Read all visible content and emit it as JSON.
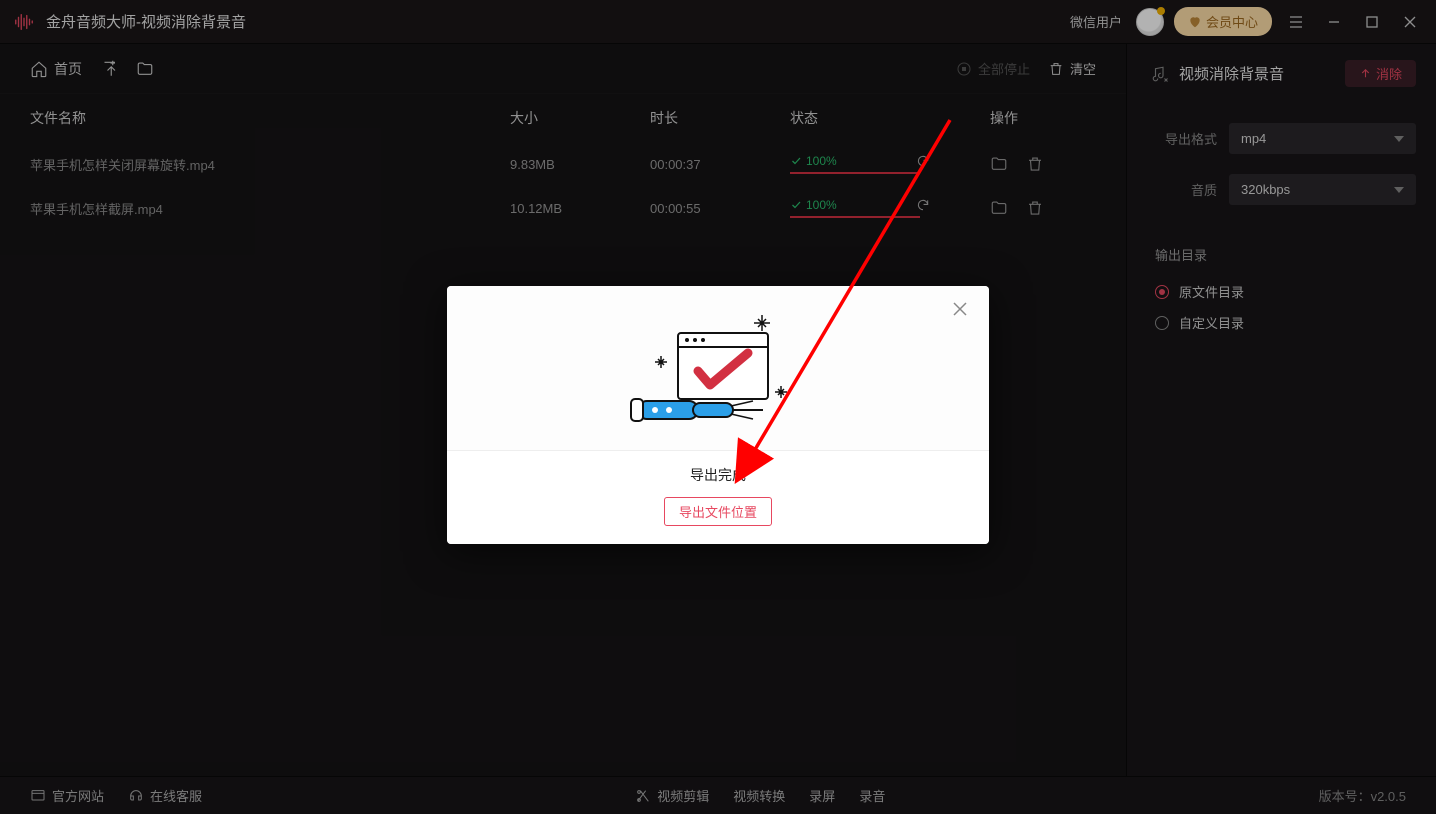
{
  "titlebar": {
    "app_title": "金舟音频大师-视频消除背景音",
    "wechat_user": "微信用户",
    "vip_label": "会员中心"
  },
  "toolbar": {
    "home": "首页",
    "stop_all": "全部停止",
    "clear": "清空"
  },
  "table": {
    "headers": {
      "name": "文件名称",
      "size": "大小",
      "duration": "时长",
      "status": "状态",
      "ops": "操作"
    },
    "rows": [
      {
        "name": "苹果手机怎样关闭屏幕旋转.mp4",
        "size": "9.83MB",
        "duration": "00:00:37",
        "percent": "100%"
      },
      {
        "name": "苹果手机怎样截屏.mp4",
        "size": "10.12MB",
        "duration": "00:00:55",
        "percent": "100%"
      }
    ]
  },
  "panel": {
    "title": "视频消除背景音",
    "remove_btn": "消除",
    "format_label": "导出格式",
    "format_value": "mp4",
    "quality_label": "音质",
    "quality_value": "320kbps",
    "output_title": "输出目录",
    "output_opt1": "原文件目录",
    "output_opt2": "自定义目录"
  },
  "footer": {
    "site": "官方网站",
    "support": "在线客服",
    "vedit": "视频剪辑",
    "vconvert": "视频转换",
    "screencap": "录屏",
    "audiorec": "录音",
    "version_label": "版本号：",
    "version_value": "v2.0.5"
  },
  "modal": {
    "msg": "导出完成",
    "btn": "导出文件位置"
  }
}
